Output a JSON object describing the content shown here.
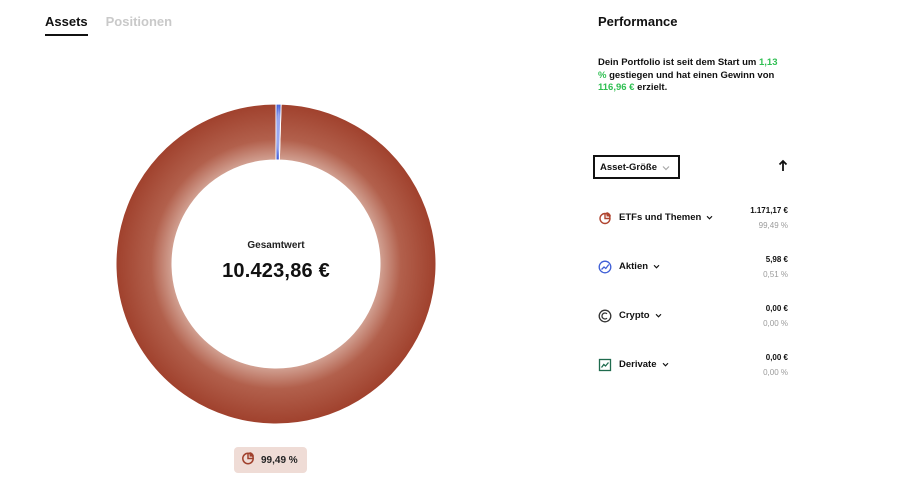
{
  "tabs": [
    {
      "label": "Assets",
      "active": true
    },
    {
      "label": "Positionen",
      "active": false
    }
  ],
  "donut": {
    "center_label": "Gesamtwert",
    "total_value": "10.423,86 €",
    "segments": [
      {
        "name": "ETFs und Themen",
        "percent": 99.49,
        "color": "#a0412d",
        "highlight": "#c7907f"
      },
      {
        "name": "Aktien",
        "percent": 0.51,
        "color": "#4a63d8",
        "highlight": "#7d8fe6"
      }
    ]
  },
  "legend": {
    "label": "99,49 %",
    "icon": "pie-chart-icon"
  },
  "performance": {
    "title": "Performance",
    "text_before": "Dein Portfolio ist seit dem Start um",
    "percent": "1,13 %",
    "text_middle": "gestiegen und hat einen Gewinn von",
    "gain": "116,96 €",
    "text_after": "erzielt.",
    "accent_color": "#2fbf52"
  },
  "sort": {
    "label": "Asset-Größe",
    "direction_icon": "arrow-up-icon"
  },
  "assets": [
    {
      "name": "ETFs und Themen",
      "amount": "1.171,17 €",
      "percent": "99,49 %",
      "icon": "pie-chart-icon",
      "color": "#b04530"
    },
    {
      "name": "Aktien",
      "amount": "5,98 €",
      "percent": "0,51 %",
      "icon": "trend-line-icon",
      "color": "#3f5fd6"
    },
    {
      "name": "Crypto",
      "amount": "0,00 €",
      "percent": "0,00 %",
      "icon": "crypto-coin-icon",
      "color": "#333333"
    },
    {
      "name": "Derivate",
      "amount": "0,00 €",
      "percent": "0,00 %",
      "icon": "chart-box-icon",
      "color": "#1f6b4e"
    }
  ]
}
